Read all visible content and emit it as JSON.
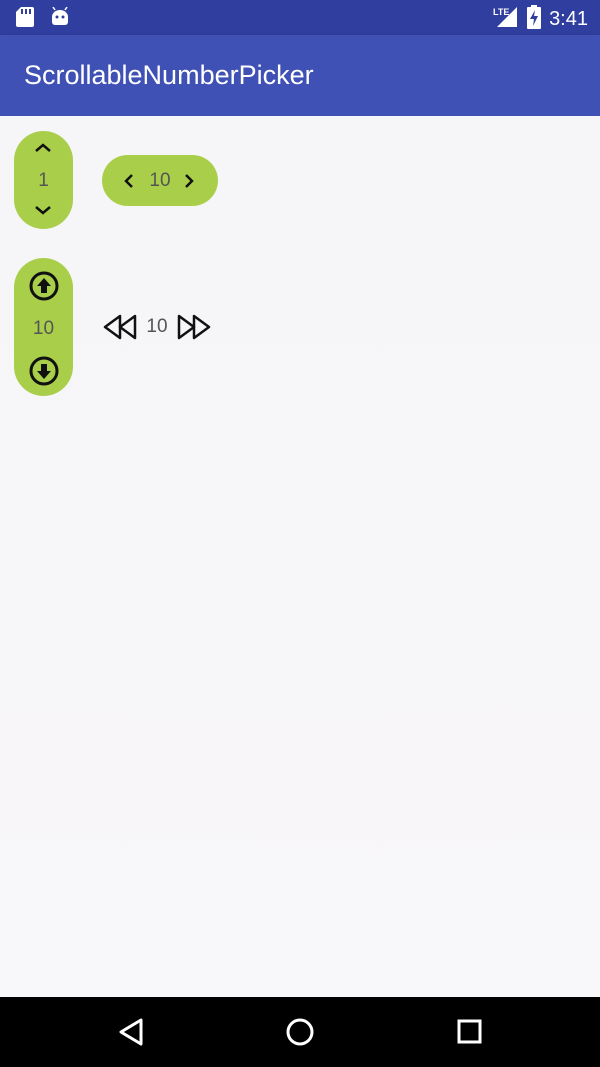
{
  "status_bar": {
    "time": "3:41",
    "network": "LTE",
    "icons": [
      "sd-card-icon",
      "android-icon",
      "signal-icon",
      "battery-charging-icon"
    ]
  },
  "app_bar": {
    "title": "ScrollableNumberPicker"
  },
  "pickers": {
    "vertical_small": {
      "value": "1",
      "increment_icon": "chevron-up-icon",
      "decrement_icon": "chevron-down-icon"
    },
    "horizontal_small": {
      "value": "10",
      "decrement_icon": "chevron-left-icon",
      "increment_icon": "chevron-right-icon"
    },
    "vertical_circle": {
      "value": "10",
      "increment_icon": "arrow-circle-up-icon",
      "decrement_icon": "arrow-circle-down-icon"
    },
    "horizontal_plain": {
      "value": "10",
      "decrement_icon": "rewind-icon",
      "increment_icon": "fast-forward-icon"
    }
  },
  "nav_bar": {
    "icons": [
      "back-icon",
      "home-icon",
      "recents-icon"
    ]
  },
  "colors": {
    "status_bar": "#303f9f",
    "app_bar": "#3f51b5",
    "picker_bg": "#a9cf4a",
    "nav_bar": "#000000"
  }
}
